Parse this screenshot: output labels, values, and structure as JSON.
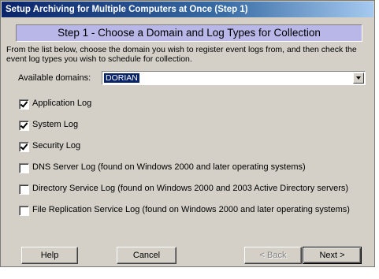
{
  "window": {
    "title": "Setup Archiving for Multiple Computers at Once (Step 1)"
  },
  "banner": "Step 1 - Choose a Domain and Log Types for Collection",
  "description": "From the list below, choose the domain you wish to register event logs from, and then check the event log types you wish to schedule for collection.",
  "domains": {
    "label": "Available domains:",
    "selected": "DORIAN"
  },
  "logs": [
    {
      "label": "Application Log",
      "checked": true
    },
    {
      "label": "System Log",
      "checked": true
    },
    {
      "label": "Security Log",
      "checked": true
    },
    {
      "label": "DNS Server Log (found on Windows 2000 and later operating systems)",
      "checked": false
    },
    {
      "label": "Directory Service Log (found on Windows 2000 and 2003 Active Directory servers)",
      "checked": false
    },
    {
      "label": "File Replication Service Log (found on Windows 2000 and later operating systems)",
      "checked": false
    }
  ],
  "buttons": {
    "help": "Help",
    "cancel": "Cancel",
    "back": "< Back",
    "next": "Next >"
  }
}
